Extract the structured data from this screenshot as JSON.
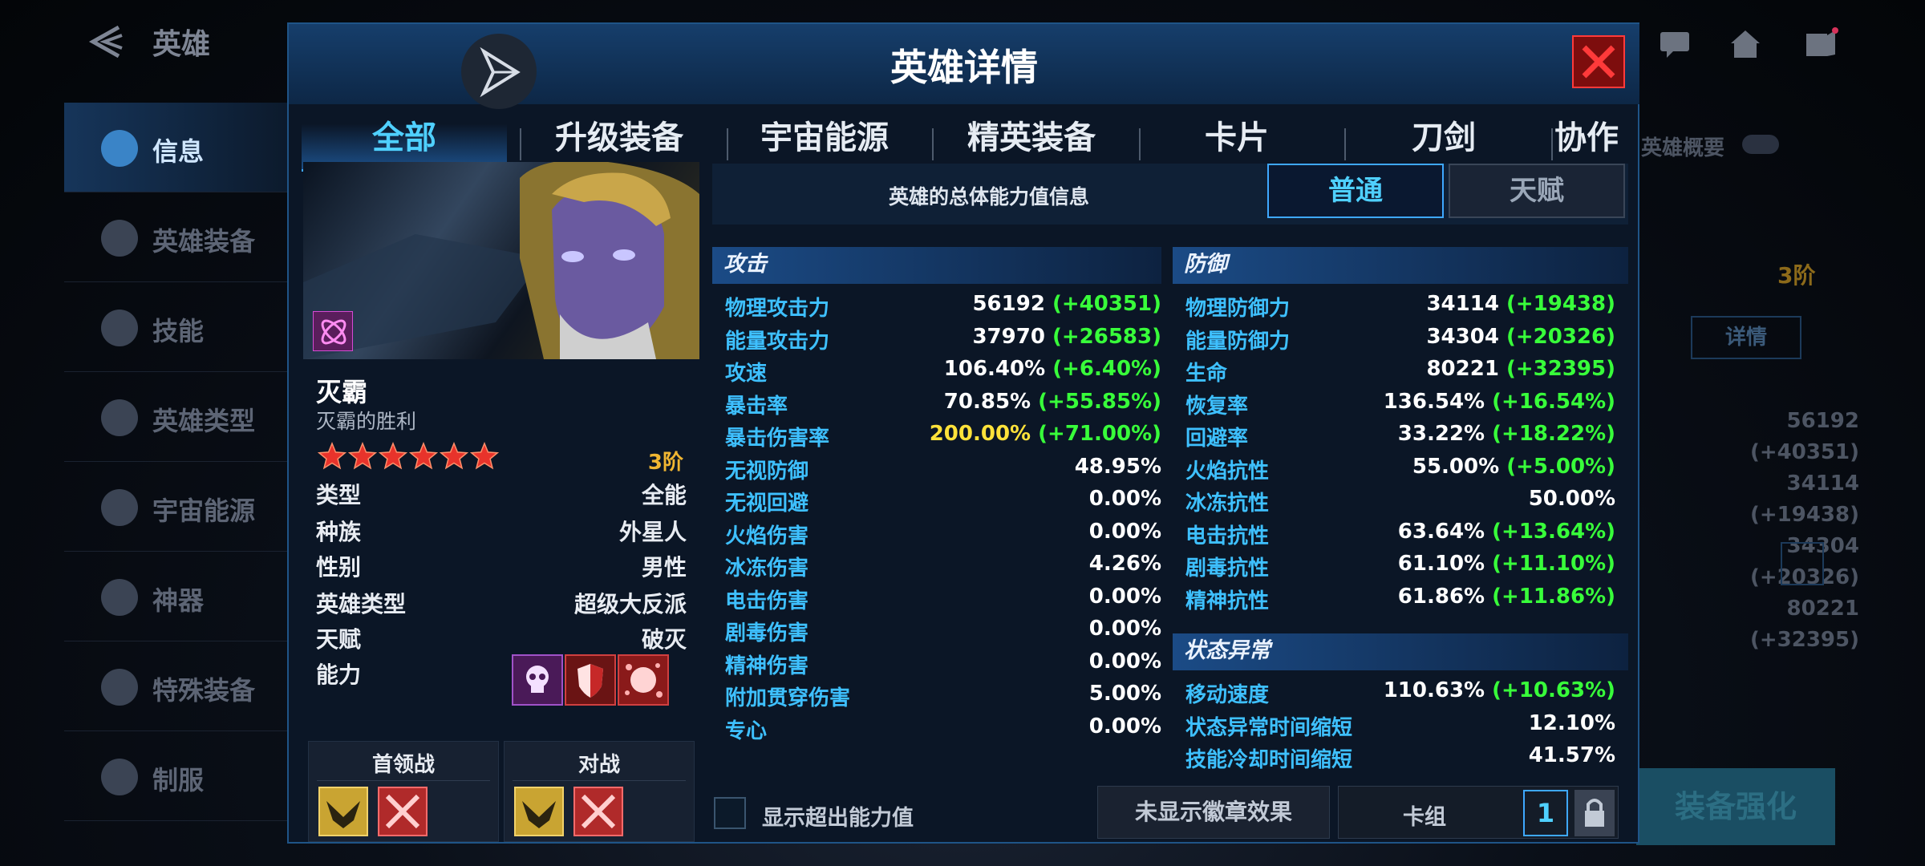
{
  "background": {
    "title": "英雄",
    "nav": [
      "信息",
      "英雄装备",
      "技能",
      "英雄类型",
      "宇宙能源",
      "神器",
      "特殊装备",
      "制服"
    ],
    "right": {
      "overview_label": "英雄概要",
      "rank": "3阶",
      "detail_btn": "详情",
      "values": [
        "56192 (+40351)",
        "34114 (+19438)",
        "34304 (+20326)",
        "80221 (+32395)"
      ],
      "enhance_btn": "装备强化"
    }
  },
  "modal": {
    "title": "英雄详情",
    "tabs": [
      "全部",
      "升级装备",
      "宇宙能源",
      "精英装备",
      "卡片",
      "刀剑",
      "协作"
    ],
    "active_tab": "全部"
  },
  "hero": {
    "name": "灭霸",
    "subtitle": "灭霸的胜利",
    "stars": 6,
    "rank": "3阶",
    "info": [
      {
        "k": "类型",
        "v": "全能"
      },
      {
        "k": "种族",
        "v": "外星人"
      },
      {
        "k": "性别",
        "v": "男性"
      },
      {
        "k": "英雄类型",
        "v": "超级大反派"
      },
      {
        "k": "天赋",
        "v": "破灭"
      },
      {
        "k": "能力",
        "v": ""
      }
    ],
    "abilities": [
      "skull-icon",
      "shield-icon",
      "fist-icon"
    ],
    "modes": [
      {
        "label": "首领战",
        "badges": [
          "eagle-badge-icon",
          "crossed-swords-icon"
        ]
      },
      {
        "label": "对战",
        "badges": [
          "eagle-badge-icon",
          "crossed-swords-icon"
        ]
      }
    ]
  },
  "stats": {
    "header": "英雄的总体能力值信息",
    "btn_normal": "普通",
    "btn_talent": "天赋",
    "attack_title": "攻击",
    "attack": [
      {
        "k": "物理攻击力",
        "v": "56192",
        "b": "(+40351)"
      },
      {
        "k": "能量攻击力",
        "v": "37970",
        "b": "(+26583)"
      },
      {
        "k": "攻速",
        "v": "106.40%",
        "b": "(+6.40%)"
      },
      {
        "k": "暴击率",
        "v": "70.85%",
        "b": "(+55.85%)"
      },
      {
        "k": "暴击伤害率",
        "v": "200.00%",
        "b": "(+71.00%)",
        "yellow": true
      },
      {
        "k": "无视防御",
        "v": "48.95%",
        "b": ""
      },
      {
        "k": "无视回避",
        "v": "0.00%",
        "b": ""
      },
      {
        "k": "火焰伤害",
        "v": "0.00%",
        "b": ""
      },
      {
        "k": "冰冻伤害",
        "v": "4.26%",
        "b": ""
      },
      {
        "k": "电击伤害",
        "v": "0.00%",
        "b": ""
      },
      {
        "k": "剧毒伤害",
        "v": "0.00%",
        "b": ""
      },
      {
        "k": "精神伤害",
        "v": "0.00%",
        "b": ""
      },
      {
        "k": "附加贯穿伤害",
        "v": "5.00%",
        "b": ""
      },
      {
        "k": "专心",
        "v": "0.00%",
        "b": ""
      }
    ],
    "defense_title": "防御",
    "defense": [
      {
        "k": "物理防御力",
        "v": "34114",
        "b": "(+19438)"
      },
      {
        "k": "能量防御力",
        "v": "34304",
        "b": "(+20326)"
      },
      {
        "k": "生命",
        "v": "80221",
        "b": "(+32395)"
      },
      {
        "k": "恢复率",
        "v": "136.54%",
        "b": "(+16.54%)"
      },
      {
        "k": "回避率",
        "v": "33.22%",
        "b": "(+18.22%)"
      },
      {
        "k": "火焰抗性",
        "v": "55.00%",
        "b": "(+5.00%)"
      },
      {
        "k": "冰冻抗性",
        "v": "50.00%",
        "b": ""
      },
      {
        "k": "电击抗性",
        "v": "63.64%",
        "b": "(+13.64%)"
      },
      {
        "k": "剧毒抗性",
        "v": "61.10%",
        "b": "(+11.10%)"
      },
      {
        "k": "精神抗性",
        "v": "61.86%",
        "b": "(+11.86%)"
      }
    ],
    "status_title": "状态异常",
    "status": [
      {
        "k": "移动速度",
        "v": "110.63%",
        "b": "(+10.63%)"
      },
      {
        "k": "状态异常时间缩短",
        "v": "12.10%",
        "b": ""
      },
      {
        "k": "技能冷却时间缩短",
        "v": "41.57%",
        "b": ""
      }
    ]
  },
  "footer": {
    "checkbox_label": "显示超出能力值",
    "badge_btn": "未显示徽章效果",
    "deck_label": "卡组",
    "deck_num": "1"
  },
  "colors": {
    "accent": "#3ea8ff",
    "bonus": "#38ff3a",
    "crit": "#ffe23a",
    "close": "#ff3a3a",
    "rank": "#f0b632"
  }
}
